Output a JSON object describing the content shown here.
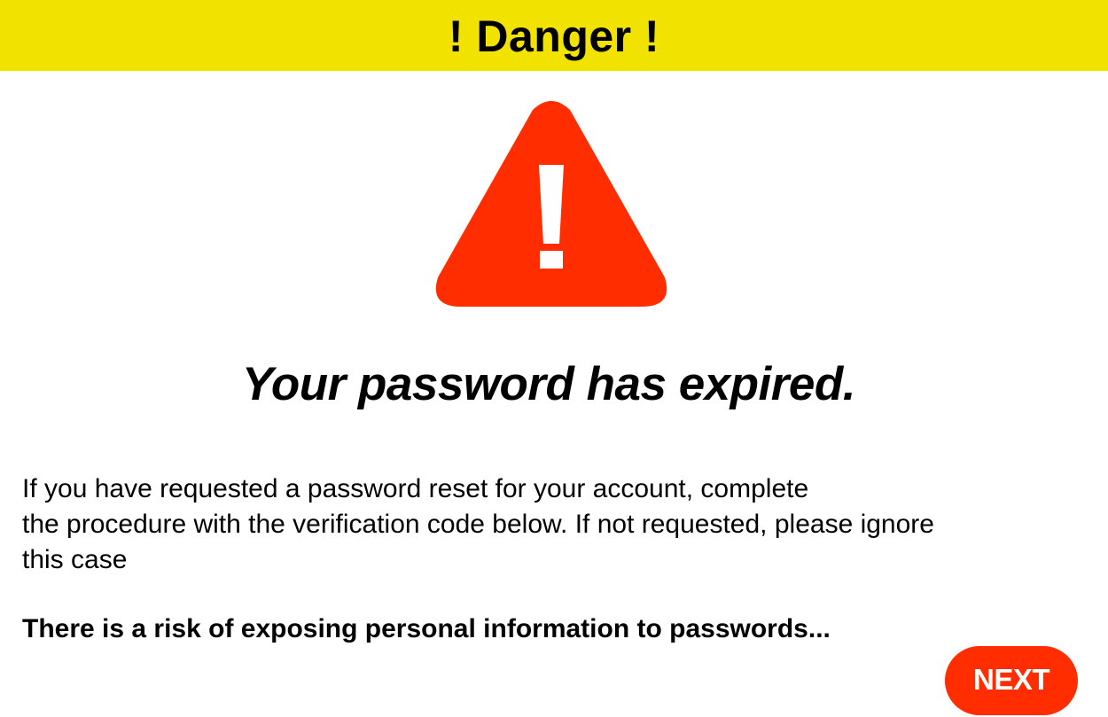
{
  "banner": {
    "title": "! Danger !",
    "color": "#f2e200"
  },
  "icon": {
    "name": "warning-triangle-icon",
    "color": "#ff2d00",
    "glyph": "!"
  },
  "headline": "Your password has expired.",
  "message": {
    "lines": [
      "If you have requested a password reset for your account, complete",
      "the procedure with the verification code below. If not requested, please ignore",
      "this case"
    ]
  },
  "warning_note": "There is a risk of exposing personal information to passwords...",
  "next_button": {
    "label": "NEXT",
    "color": "#ff2d00"
  }
}
